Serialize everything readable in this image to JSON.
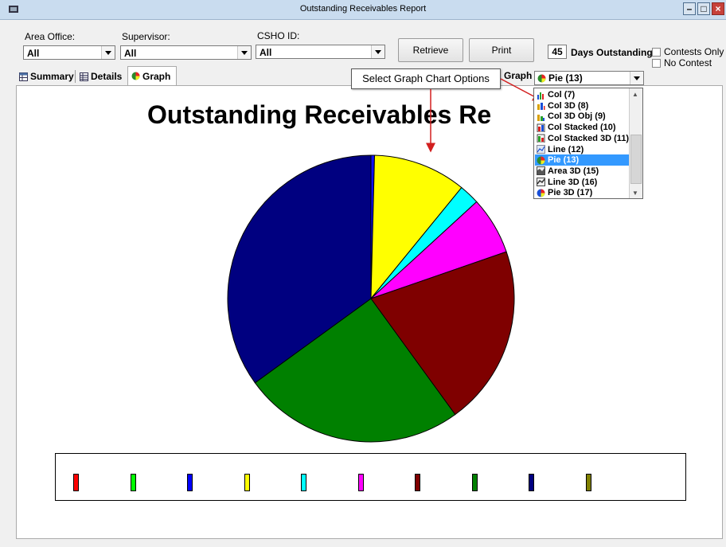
{
  "window": {
    "title": "Outstanding Receivables Report"
  },
  "filters": {
    "area_office_label": "Area Office:",
    "area_office_value": "All",
    "supervisor_label": "Supervisor:",
    "supervisor_value": "All",
    "csho_label": "CSHO ID:",
    "csho_value": "All"
  },
  "toolbar": {
    "retrieve_label": "Retrieve",
    "print_label": "Print",
    "days_value": "45",
    "days_label": "Days Outstanding",
    "contests_only_label": "Contests Only",
    "no_contest_label": "No Contest"
  },
  "tabs": [
    {
      "label": "Summary",
      "icon": "summary-grid-icon"
    },
    {
      "label": "Details",
      "icon": "details-table-icon"
    },
    {
      "label": "Graph",
      "icon": "pie-chart-icon"
    }
  ],
  "graph_selector": {
    "label": "Graph",
    "selected": "Pie (13)",
    "options": [
      {
        "label": "Col (7)",
        "icon": "column-chart-icon"
      },
      {
        "label": "Col 3D (8)",
        "icon": "column-3d-chart-icon"
      },
      {
        "label": "Col 3D Obj (9)",
        "icon": "column-3d-object-chart-icon"
      },
      {
        "label": "Col Stacked (10)",
        "icon": "column-stacked-chart-icon"
      },
      {
        "label": "Col Stacked 3D (11)",
        "icon": "column-stacked-3d-chart-icon"
      },
      {
        "label": "Line (12)",
        "icon": "line-chart-icon"
      },
      {
        "label": "Pie (13)",
        "icon": "pie-chart-icon"
      },
      {
        "label": "Area 3D (15)",
        "icon": "area-3d-chart-icon"
      },
      {
        "label": "Line 3D (16)",
        "icon": "line-3d-chart-icon"
      },
      {
        "label": "Pie 3D (17)",
        "icon": "pie-3d-chart-icon"
      }
    ]
  },
  "callout": {
    "text": "Select Graph Chart Options"
  },
  "chart_data": {
    "type": "pie",
    "title": "Outstanding Receivables Re",
    "slices": [
      {
        "value": 0.4,
        "color": "#1010ff"
      },
      {
        "value": 10.5,
        "color": "#ffff00"
      },
      {
        "value": 2.3,
        "color": "#00ffff"
      },
      {
        "value": 6.5,
        "color": "#ff00ff"
      },
      {
        "value": 20.3,
        "color": "#7f0000"
      },
      {
        "value": 25.0,
        "color": "#008000"
      },
      {
        "value": 35.0,
        "color": "#000080"
      }
    ],
    "legend": {
      "colors": [
        "#ff0000",
        "#00ff00",
        "#0000ff",
        "#ffff00",
        "#00ffff",
        "#ff00ff",
        "#800000",
        "#008000",
        "#000080",
        "#808000"
      ]
    }
  }
}
